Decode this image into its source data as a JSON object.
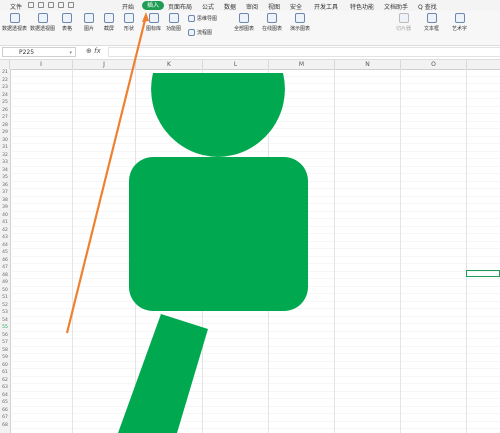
{
  "menubar": {
    "file": "文件",
    "tabs": [
      "开始",
      "插入",
      "页面布局",
      "公式",
      "数据",
      "审阅",
      "视图",
      "安全",
      "开发工具",
      "特色功能",
      "文档助手",
      "Q 查找"
    ],
    "active_tab": "插入"
  },
  "ribbon": {
    "buttons": [
      "数据透视表",
      "数据透视图",
      "表格",
      "图片",
      "截屏",
      "形状",
      "图标库",
      "功能图",
      "全部图表",
      "在线图表",
      "演示图表",
      "切片器",
      "文本框",
      "艺术字"
    ],
    "small_buttons": [
      "思维导图",
      "流程图"
    ]
  },
  "formula_bar": {
    "name_box": "P225",
    "fx": "fx"
  },
  "columns": [
    "I",
    "J",
    "K",
    "L",
    "M",
    "N",
    "O"
  ],
  "rows": [
    "21",
    "22",
    "23",
    "24",
    "25",
    "26",
    "27",
    "28",
    "29",
    "30",
    "31",
    "32",
    "33",
    "34",
    "35",
    "36",
    "37",
    "38",
    "39",
    "40",
    "41",
    "42",
    "43",
    "44",
    "45",
    "46",
    "47",
    "48",
    "49",
    "50",
    "51",
    "52",
    "53",
    "54",
    "55",
    "56",
    "57",
    "58",
    "59",
    "60",
    "61",
    "62",
    "63",
    "64",
    "65",
    "66",
    "67",
    "68"
  ],
  "colors": {
    "shape_fill": "#00a94f",
    "accent": "#1f9d55",
    "arrow": "#f08030"
  }
}
